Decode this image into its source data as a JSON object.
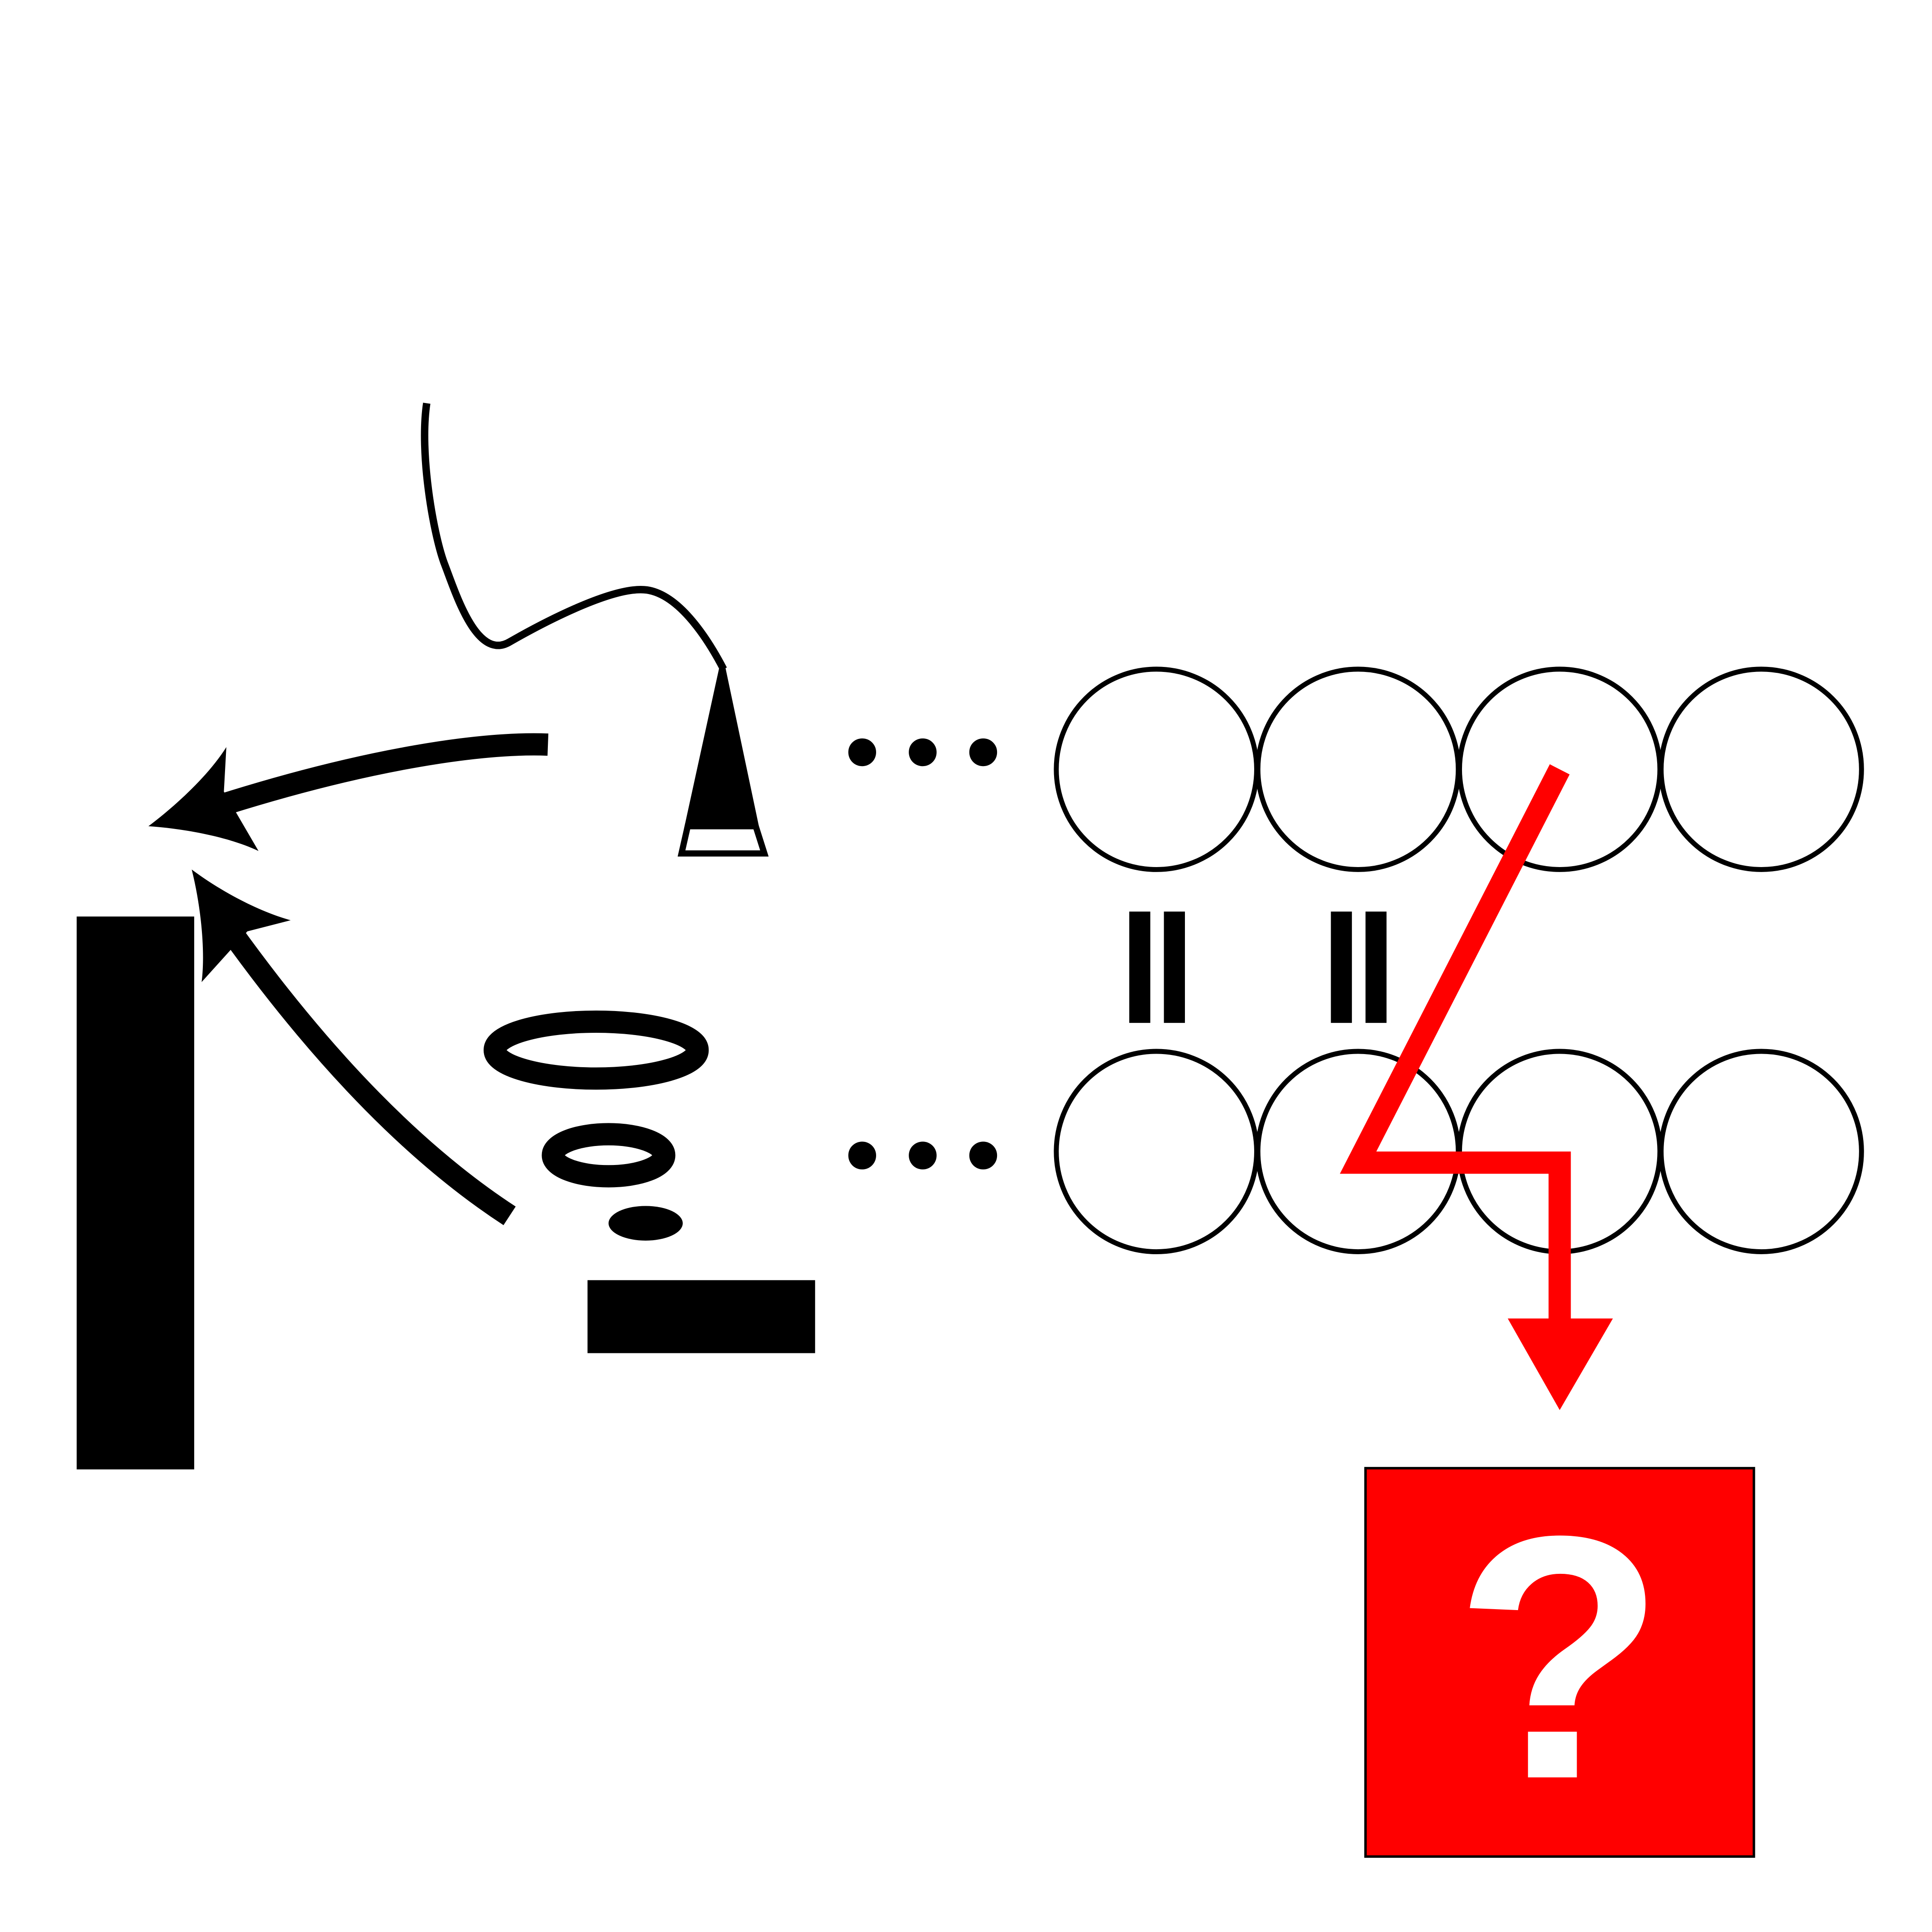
{
  "ellipsis_symbol": "•••",
  "question_mark": "?",
  "colors": {
    "ink": "#000000",
    "accent": "#ff0000",
    "background": "#ffffff",
    "question_fill": "#ffffff"
  },
  "icons": {
    "funnel": "funnel-icon",
    "stacked_ellipses": "stacked-ellipses-icon",
    "equals_sign": "vertical-equals-icon"
  }
}
